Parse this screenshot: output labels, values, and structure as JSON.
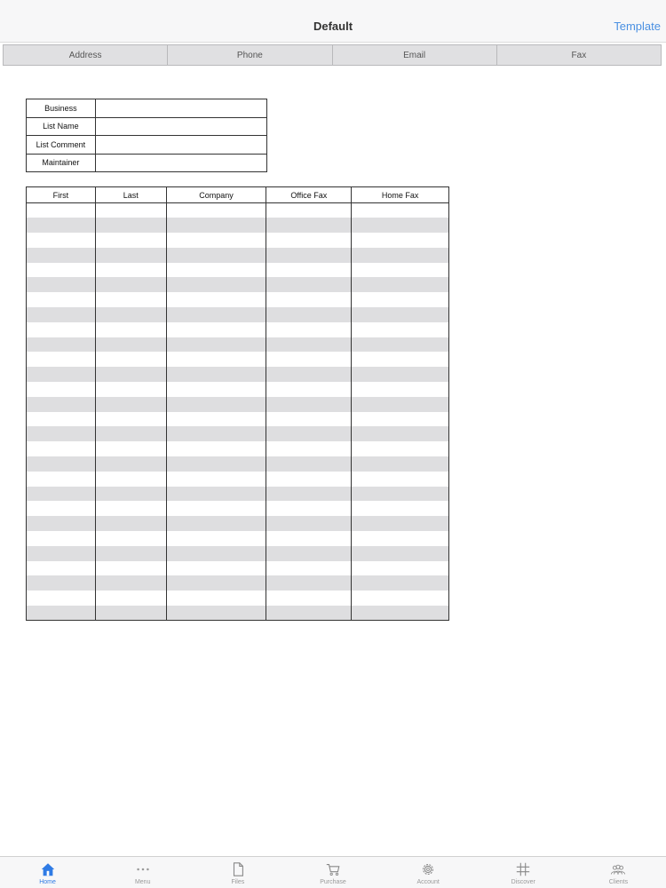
{
  "nav": {
    "title": "Default",
    "right_button": "Template"
  },
  "segments": [
    "Address",
    "Phone",
    "Email",
    "Fax"
  ],
  "info_fields": [
    {
      "label": "Business",
      "value": ""
    },
    {
      "label": "List Name",
      "value": ""
    },
    {
      "label": "List Comment",
      "value": ""
    },
    {
      "label": "Maintainer",
      "value": ""
    }
  ],
  "grid": {
    "columns": [
      "First",
      "Last",
      "Company",
      "Office Fax",
      "Home Fax"
    ],
    "row_count": 28
  },
  "tabbar": {
    "active": "Home",
    "items": [
      {
        "label": "Home",
        "icon": "home-icon"
      },
      {
        "label": "Menu",
        "icon": "more-dots-icon"
      },
      {
        "label": "Files",
        "icon": "file-icon"
      },
      {
        "label": "Purchase",
        "icon": "cart-icon"
      },
      {
        "label": "Account",
        "icon": "gear-icon"
      },
      {
        "label": "Discover",
        "icon": "hashtag-icon"
      },
      {
        "label": "Clients",
        "icon": "people-icon"
      }
    ]
  },
  "colors": {
    "accent": "#2f7be5",
    "stripe": "#dedee0",
    "link": "#4a90e2"
  }
}
